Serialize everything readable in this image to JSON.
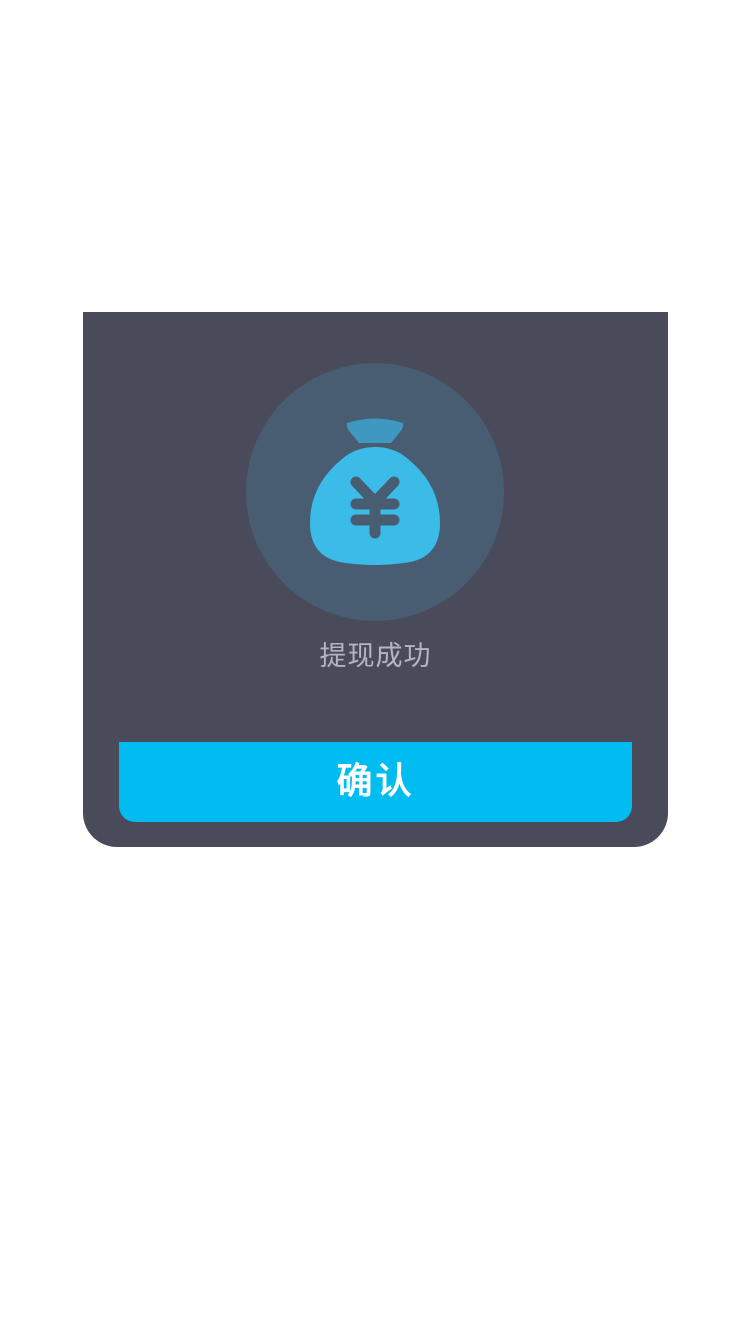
{
  "dialog": {
    "icon": "money-bag-yuan-icon",
    "message": "提现成功",
    "confirm_label": "确认"
  },
  "colors": {
    "page_background": "#ffffff",
    "dialog_background": "#4a4b5a",
    "icon_circle": "#485c72",
    "icon_accent": "#3bbbe8",
    "button_background": "#00bcf1",
    "button_text": "#ffffff",
    "message_text": "#b4b5bf"
  }
}
